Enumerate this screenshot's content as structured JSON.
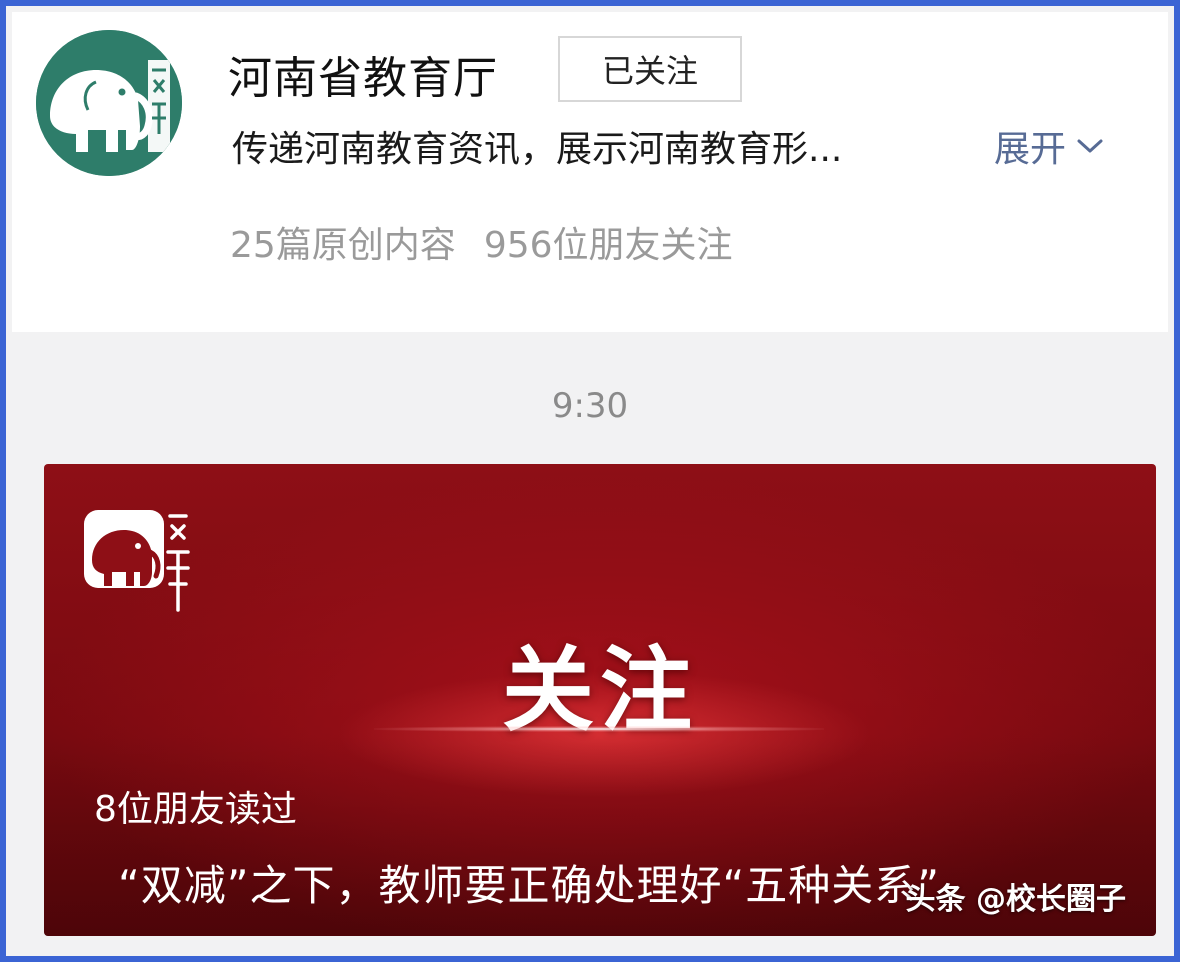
{
  "account": {
    "name": "河南省教育厅",
    "follow_label": "已关注",
    "description": "传递河南教育资讯，展示河南教育形...",
    "expand_label": "展开",
    "stats": {
      "original": "25篇原创内容",
      "friends_following": "956位朋友关注"
    }
  },
  "timestamp": "9:30",
  "article": {
    "cover_text": "关注",
    "readers": "8位朋友读过",
    "title": "“双减”之下，教师要正确处理好“五种关系”"
  },
  "watermark": "头条 @校长圈子",
  "colors": {
    "border": "#3b64d4",
    "link": "#576b95",
    "avatar_green": "#2e7d6a",
    "card_red": "#8e0f16"
  },
  "icons": {
    "avatar": "elephant-logo",
    "card_logo": "elephant-logo",
    "expand": "chevron-down-icon"
  }
}
